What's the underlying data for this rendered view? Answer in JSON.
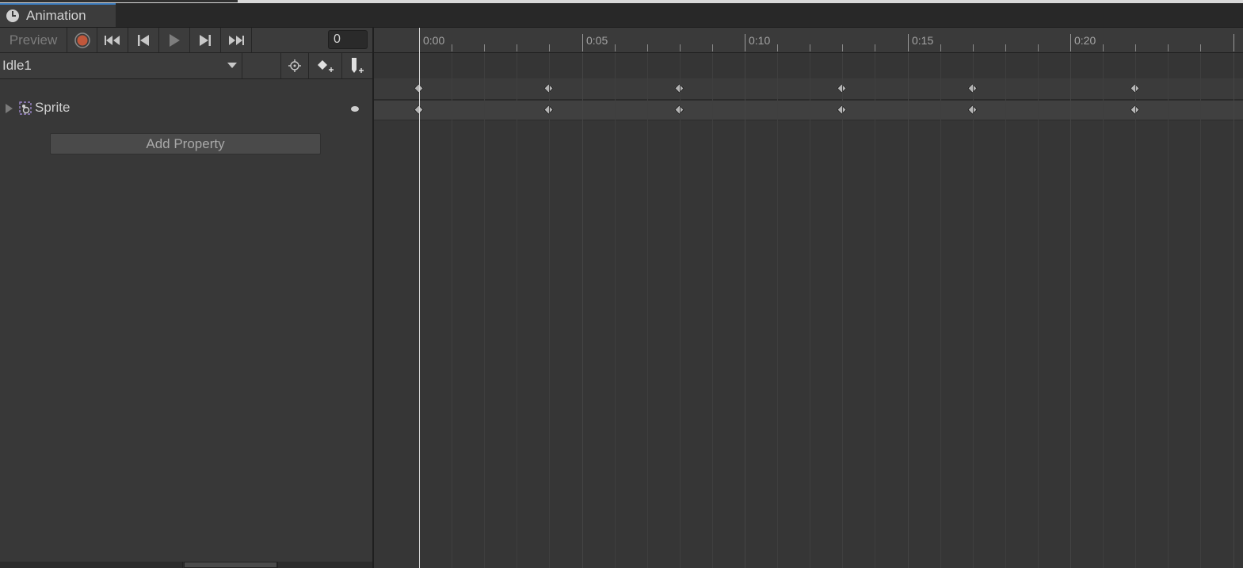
{
  "window": {
    "tab_title": "Animation"
  },
  "toolbar": {
    "preview_label": "Preview",
    "frame_value": "0",
    "buttons": [
      "record-icon",
      "first-key-icon",
      "prev-key-icon",
      "play-icon",
      "next-key-icon",
      "last-key-icon"
    ]
  },
  "clip": {
    "name": "Idle1",
    "buttons": [
      "filter-by-selection-icon",
      "add-keyframe-icon",
      "add-event-icon"
    ]
  },
  "properties": [
    {
      "label": "Sprite",
      "icon": "sprite-renderer-icon"
    }
  ],
  "add_property_label": "Add Property",
  "timeline": {
    "labels": [
      "0:00",
      "0:05",
      "0:10",
      "0:15",
      "0:20"
    ],
    "current_frame": 0,
    "keyframes": [
      0,
      4,
      8,
      13,
      17,
      22
    ]
  },
  "colors": {
    "record": "#c0573b",
    "tab_accent": "#3a79bb",
    "playhead": "#d8d8d8"
  }
}
